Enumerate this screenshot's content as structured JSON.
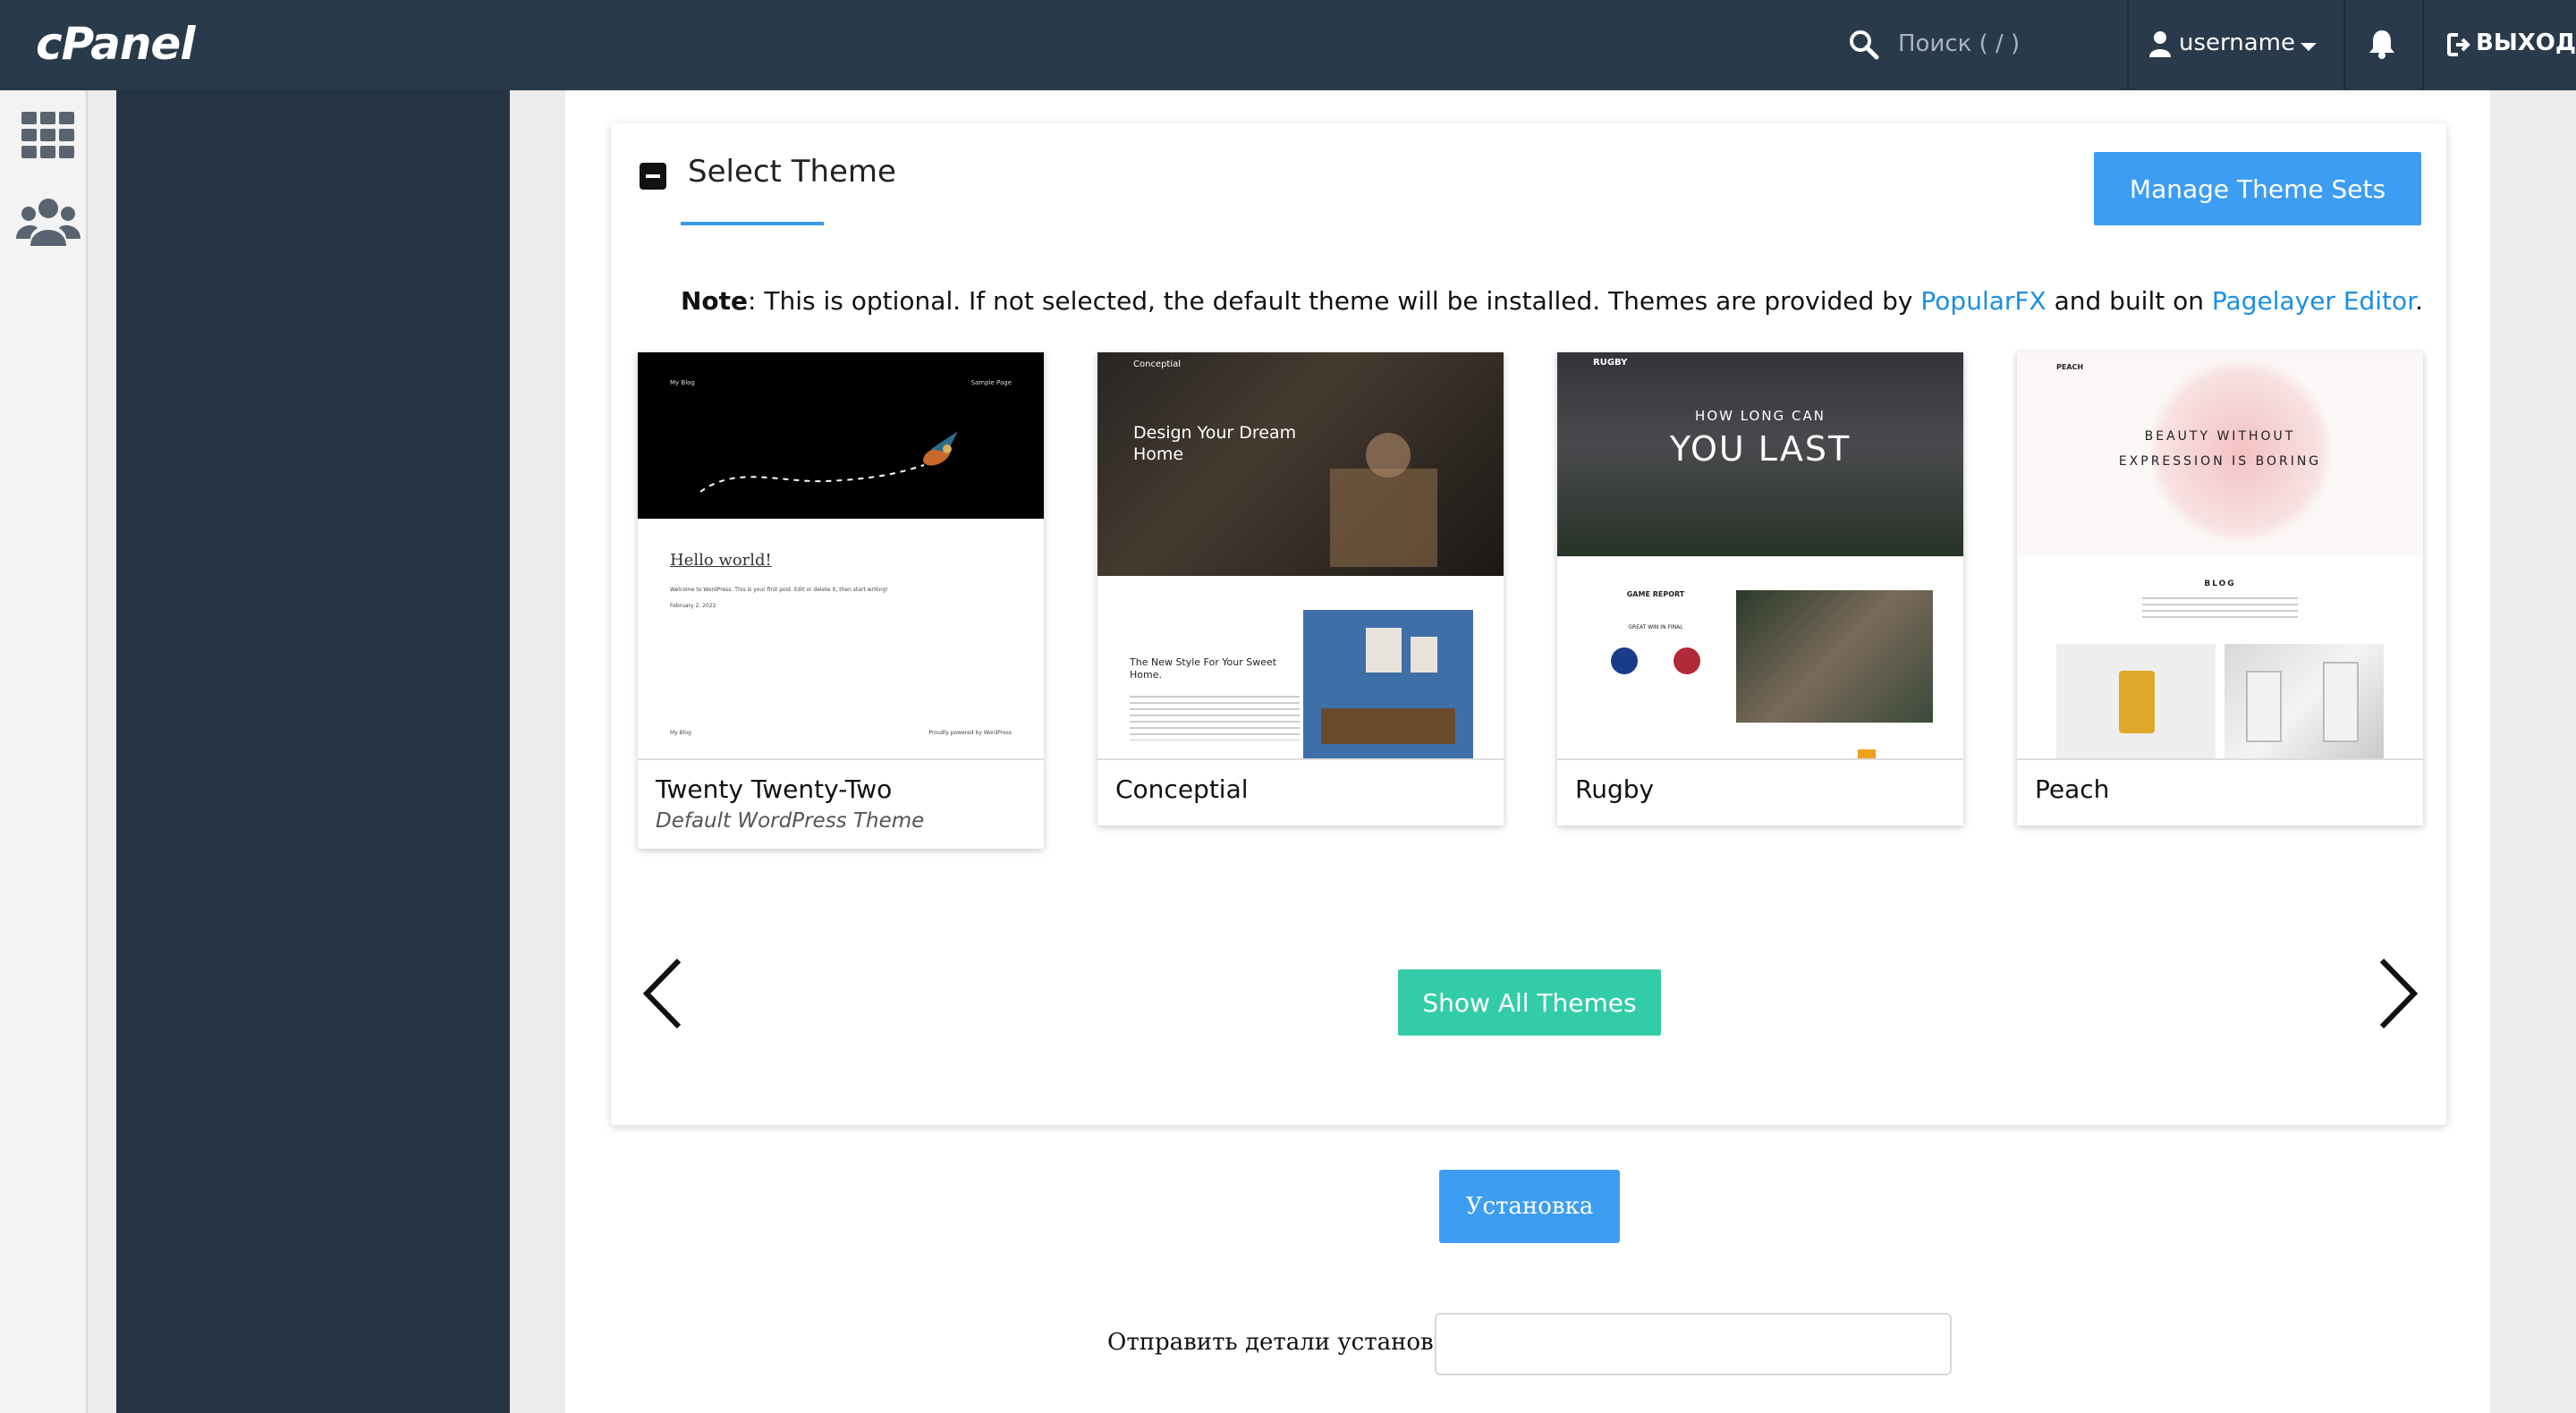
{
  "header": {
    "logo": "cPanel",
    "search_placeholder": "Поиск ( / )",
    "username": "username",
    "logout": "ВЫХОД"
  },
  "card": {
    "title": "Select Theme",
    "manage_button": "Manage Theme Sets",
    "note_label": "Note",
    "note_text_1": ": This is optional. If not selected, the default theme will be installed. Themes are provided by ",
    "note_link_1": "PopularFX",
    "note_text_2": " and built on ",
    "note_link_2": "Pagelayer Editor",
    "note_text_3": ".",
    "show_all_button": "Show All Themes"
  },
  "themes": [
    {
      "name": "Twenty Twenty-Two",
      "subtitle": "Default WordPress Theme",
      "preview": {
        "nav_left": "My Blog",
        "nav_right": "Sample Page",
        "heading": "Hello world!",
        "body": "Welcome to WordPress. This is your first post. Edit or delete it, then start writing!",
        "date": "February 2, 2022",
        "footer_left": "My Blog",
        "footer_right": "Proudly powered by WordPress"
      }
    },
    {
      "name": "Conceptial",
      "subtitle": "",
      "preview": {
        "brand": "Conceptial",
        "hero": "Design Your Dream Home",
        "section": "The New Style For Your Sweet Home."
      }
    },
    {
      "name": "Rugby",
      "subtitle": "",
      "preview": {
        "brand": "RUGBY",
        "hero_small": "HOW LONG CAN",
        "hero_big": "YOU LAST",
        "report": "GAME REPORT",
        "final": "GREAT WIN IN FINAL"
      }
    },
    {
      "name": "Peach",
      "subtitle": "",
      "preview": {
        "brand": "PEACH",
        "hero_1": "BEAUTY WITHOUT",
        "hero_2": "EXPRESSION IS BORING",
        "blog": "BLOG"
      }
    }
  ],
  "install": {
    "button": "Установка",
    "send_label": "Отправить детали установки :",
    "send_value": ""
  }
}
